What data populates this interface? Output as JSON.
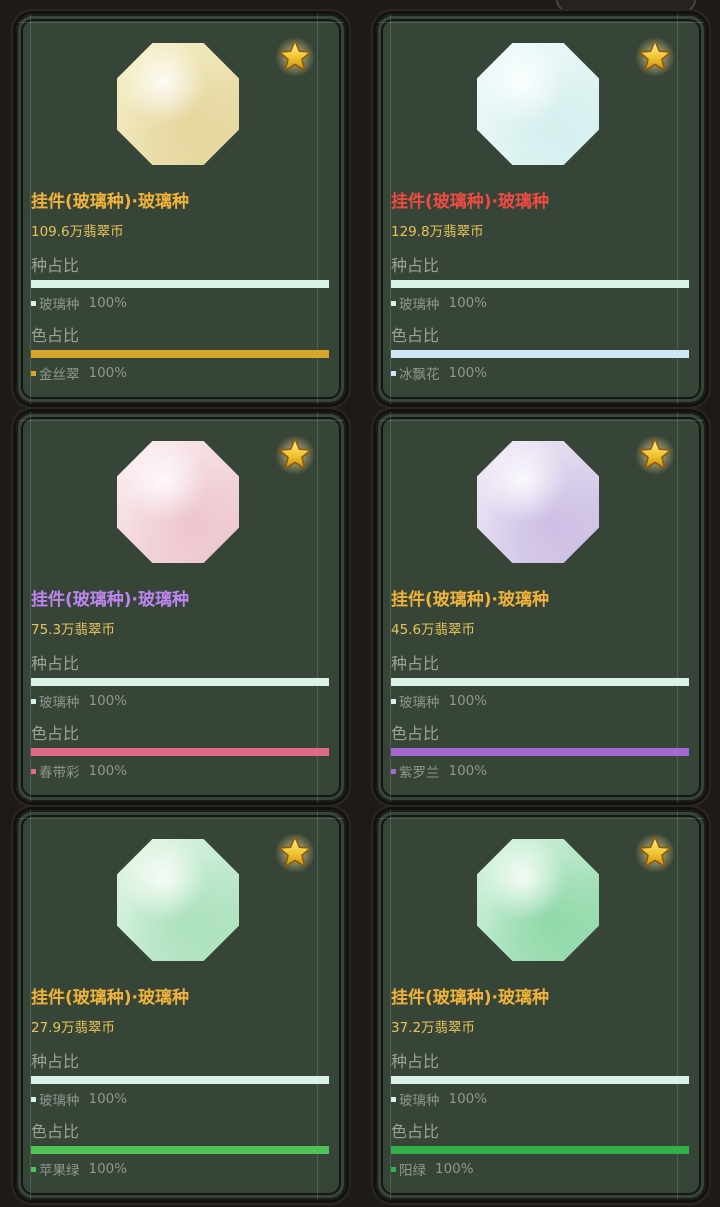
{
  "labels": {
    "seed_ratio": "种占比",
    "color_ratio": "色占比"
  },
  "cards": [
    {
      "title": "挂件(玻璃种)·玻璃种",
      "title_color": "#efb23a",
      "price": "109.6万翡翠币",
      "seed_name": "玻璃种",
      "seed_pct": "100%",
      "seed_color": "#daf1e7",
      "color_name": "金丝翠",
      "color_pct": "100%",
      "color_color": "#d7a52c",
      "gem_tint": [
        "#f6f0c9",
        "#e6d69a"
      ],
      "starred": true,
      "star_icon": "gold-star-icon"
    },
    {
      "title": "挂件(玻璃种)·玻璃种",
      "title_color": "#ef4b41",
      "price": "129.8万翡翠币",
      "seed_name": "玻璃种",
      "seed_pct": "100%",
      "seed_color": "#daf1e7",
      "color_name": "冰飘花",
      "color_pct": "100%",
      "color_color": "#cfe7f6",
      "gem_tint": [
        "#f1fbfb",
        "#d4efee"
      ],
      "starred": true,
      "star_icon": "gold-star-icon"
    },
    {
      "title": "挂件(玻璃种)·玻璃种",
      "title_color": "#be84f0",
      "price": "75.3万翡翠币",
      "seed_name": "玻璃种",
      "seed_pct": "100%",
      "seed_color": "#daf1e7",
      "color_name": "春带彩",
      "color_pct": "100%",
      "color_color": "#df6b86",
      "gem_tint": [
        "#fbeef0",
        "#efc6cf"
      ],
      "starred": true,
      "star_icon": "gold-star-icon"
    },
    {
      "title": "挂件(玻璃种)·玻璃种",
      "title_color": "#efb23a",
      "price": "45.6万翡翠币",
      "seed_name": "玻璃种",
      "seed_pct": "100%",
      "seed_color": "#daf1e7",
      "color_name": "紫罗兰",
      "color_pct": "100%",
      "color_color": "#a468ce",
      "gem_tint": [
        "#f1ecf8",
        "#cdbfe6"
      ],
      "starred": true,
      "star_icon": "gold-star-icon"
    },
    {
      "title": "挂件(玻璃种)·玻璃种",
      "title_color": "#efb23a",
      "price": "27.9万翡翠币",
      "seed_name": "玻璃种",
      "seed_pct": "100%",
      "seed_color": "#daf1e7",
      "color_name": "苹果绿",
      "color_pct": "100%",
      "color_color": "#4fc25a",
      "gem_tint": [
        "#e3f6e8",
        "#a9e2bb"
      ],
      "starred": true,
      "star_icon": "gold-star-icon"
    },
    {
      "title": "挂件(玻璃种)·玻璃种",
      "title_color": "#efb23a",
      "price": "37.2万翡翠币",
      "seed_name": "玻璃种",
      "seed_pct": "100%",
      "seed_color": "#daf1e7",
      "color_name": "阳绿",
      "color_pct": "100%",
      "color_color": "#33b04a",
      "gem_tint": [
        "#d9f4e2",
        "#8ddaa8"
      ],
      "starred": true,
      "star_icon": "gold-star-icon"
    }
  ]
}
